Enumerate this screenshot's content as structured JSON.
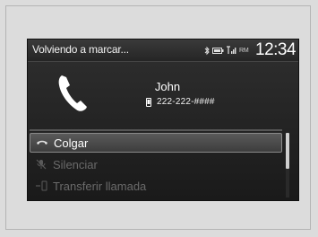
{
  "status_bar": {
    "title": "Volviendo a marcar...",
    "icons": [
      "bluetooth-icon",
      "battery-icon",
      "signal-icon"
    ],
    "roaming_label": "RM",
    "clock": "12:34"
  },
  "call": {
    "contact_name": "John",
    "contact_number": "222-222-####",
    "icons": [
      "phone-handset-icon",
      "mobile-phone-icon"
    ]
  },
  "menu": {
    "items": [
      {
        "label": "Colgar",
        "icon": "hang-up-icon",
        "state": "selected"
      },
      {
        "label": "Silenciar",
        "icon": "mute-icon",
        "state": "disabled"
      },
      {
        "label": "Transferir llamada",
        "icon": "transfer-call-icon",
        "state": "disabled"
      }
    ]
  },
  "scrollbar": {
    "position": 0.0
  },
  "colors": {
    "screen_bg": "#1f1f1f",
    "selected_bg": "#4a4a4a",
    "text_primary": "#ffffff",
    "text_disabled": "#6a6a6a",
    "page_bg": "#dcdcdc"
  }
}
